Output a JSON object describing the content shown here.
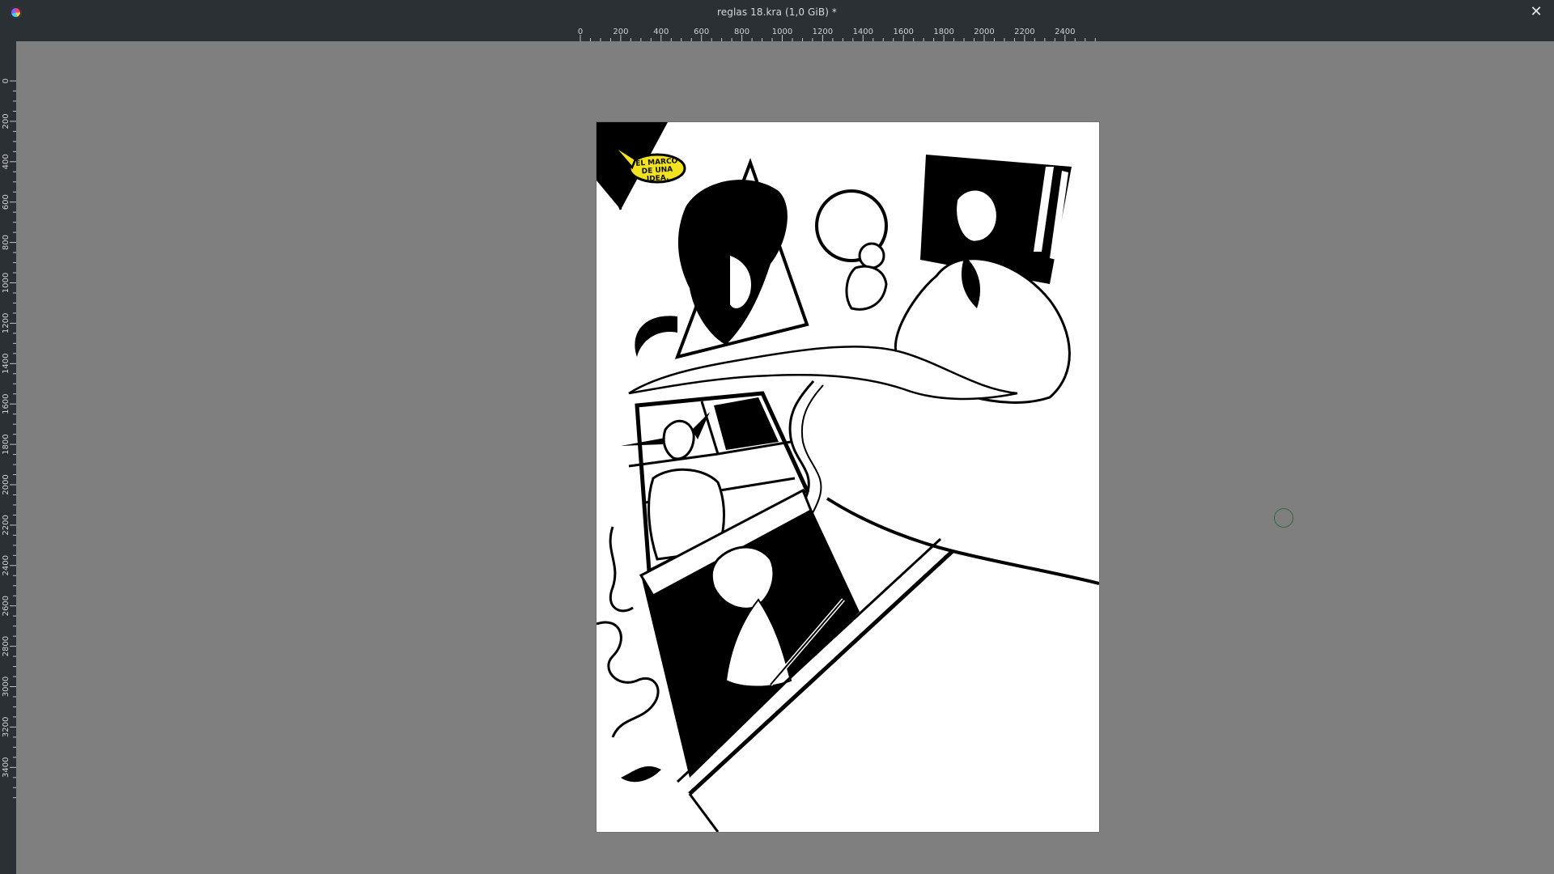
{
  "window": {
    "title": "reglas 18.kra (1,0 GiB) *",
    "close_glyph": "✕",
    "app_icon": "krita-logo-icon"
  },
  "rulers": {
    "horizontal_labels": [
      "0",
      "200",
      "400",
      "600",
      "800",
      "1000",
      "1200",
      "1400",
      "1600",
      "1800",
      "2000",
      "2200",
      "2400"
    ],
    "vertical_labels": [
      "0",
      "200",
      "400",
      "600",
      "800",
      "1000",
      "1200",
      "1400",
      "1600",
      "1800",
      "2000",
      "2200",
      "2400",
      "2600",
      "2800",
      "3000",
      "3200",
      "3400"
    ]
  },
  "artwork": {
    "speech_bubble_line1": "EL MARCO",
    "speech_bubble_line2": "DE UNA IDEA."
  },
  "colors": {
    "titlebar_bg": "#2b3035",
    "canvas_bg": "#7f7f7f",
    "bubble_fill": "#f2e320"
  }
}
